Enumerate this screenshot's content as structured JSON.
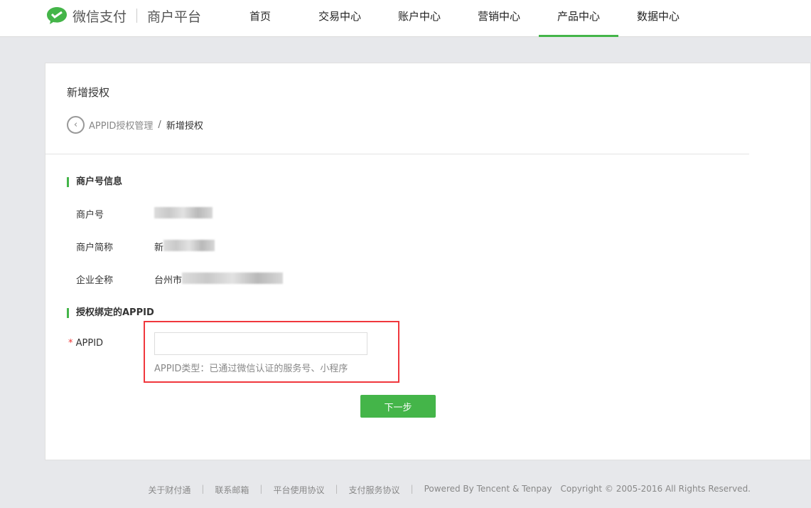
{
  "header": {
    "brand": "微信支付",
    "platform": "商户平台",
    "nav": [
      "首页",
      "交易中心",
      "账户中心",
      "营销中心",
      "产品中心",
      "数据中心"
    ],
    "active": "产品中心"
  },
  "page": {
    "title": "新增授权",
    "breadcrumb_parent": "APPID授权管理",
    "breadcrumb_sep": "/",
    "breadcrumb_current": "新增授权"
  },
  "merchant": {
    "section": "商户号信息",
    "id_label": "商户号",
    "short_label": "商户简称",
    "short_value_visible": "新",
    "full_label": "企业全称",
    "full_value_visible": "台州市"
  },
  "appid": {
    "section": "授权绑定的APPID",
    "required_mark": "*",
    "label": "APPID",
    "value": "",
    "hint": "APPID类型：已通过微信认证的服务号、小程序",
    "next": "下一步"
  },
  "footer": {
    "links": [
      "关于财付通",
      "联系邮箱",
      "平台使用协议",
      "支付服务协议"
    ],
    "powered": "Powered By Tencent & Tenpay",
    "copyright": "Copyright © 2005-2016 All Rights Reserved."
  },
  "colors": {
    "accent": "#44b549",
    "highlight": "#f0373d"
  }
}
